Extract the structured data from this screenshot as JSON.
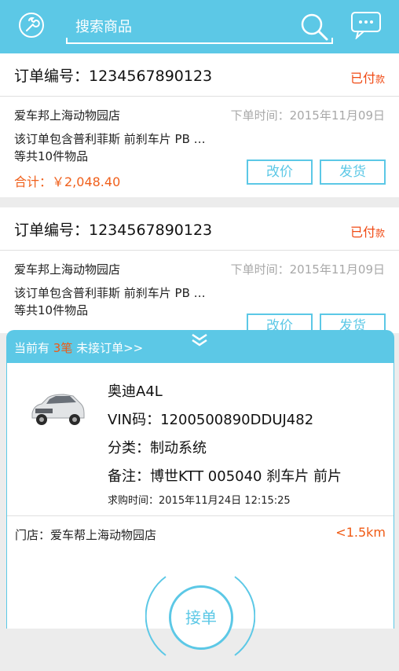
{
  "header": {
    "search_placeholder": "搜索商品"
  },
  "orders": [
    {
      "order_no": "订单编号：1234567890123",
      "status_main": "已付",
      "status_sub": "款",
      "shop": "爱车邦上海动物园店",
      "time": "下单时间：2015年11月09日",
      "desc_line1": "该订单包含普利菲斯 前刹车片 PB …",
      "desc_line2": "等共10件物品",
      "total": "合计：￥2,048.40",
      "btn_price": "改价",
      "btn_ship": "发货"
    },
    {
      "order_no": "订单编号：1234567890123",
      "status_main": "已付",
      "status_sub": "款",
      "shop": "爱车邦上海动物园店",
      "time": "下单时间：2015年11月09日",
      "desc_line1": "该订单包含普利菲斯 前刹车片 PB …",
      "desc_line2": "等共10件物品",
      "btn_price": "改价",
      "btn_ship": "发货"
    }
  ],
  "popup": {
    "title_prefix": "当前有 ",
    "count": "3笔",
    "title_suffix": " 未接订单>>",
    "car_model": "奥迪A4L",
    "vin": "VIN码：1200500890DDUJ482",
    "category": "分类：制动系统",
    "note": "备注：博世KTT 005040 刹车片 前片",
    "request_time": "求购时间：2015年11月24日 12:15:25",
    "store": "门店：爱车帮上海动物园店",
    "distance": "<1.5km",
    "accept_label": "接单"
  },
  "colors": {
    "primary": "#5cc8e6",
    "accent": "#f04a14"
  }
}
